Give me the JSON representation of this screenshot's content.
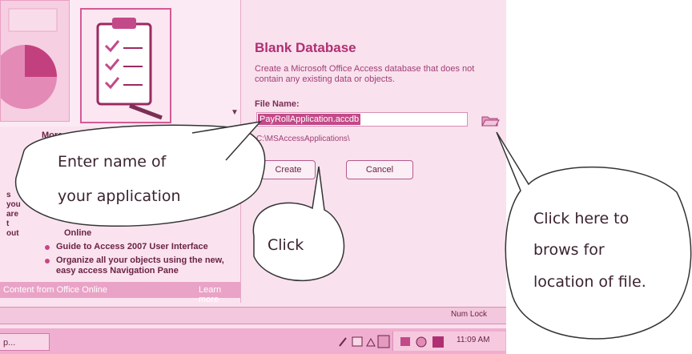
{
  "gallery": {
    "more_link": "More"
  },
  "side_fragments": [
    "s",
    "you",
    "are",
    "t",
    "out"
  ],
  "getting_started": {
    "items": [
      "Online",
      "Guide to Access 2007 User Interface",
      "Organize all your objects using the new, easy access Navigation Pane"
    ],
    "online_bar_text": "Content from Office Online",
    "learn_more": "Learn more"
  },
  "blank_db": {
    "title": "Blank Database",
    "description": "Create a Microsoft Office Access database that does not contain any existing data or objects.",
    "file_name_label": "File Name:",
    "file_name_value": "PayRollApplication.accdb",
    "path": "C:\\MSAccessApplications\\",
    "create_label": "Create",
    "cancel_label": "Cancel",
    "folder_icon": "open-folder-icon"
  },
  "status_bar": {
    "num_lock": "Num Lock"
  },
  "taskbar": {
    "start_label": "p...",
    "clock": "11:09 AM"
  },
  "callouts": {
    "enter_name": [
      "Enter  name of",
      "your application"
    ],
    "click": "Click",
    "browse": [
      "Click here to",
      "brows for",
      "location of file."
    ]
  },
  "colors": {
    "accent": "#b02f72",
    "background": "#f9e1ee",
    "callout_fill": "#ffffff"
  }
}
